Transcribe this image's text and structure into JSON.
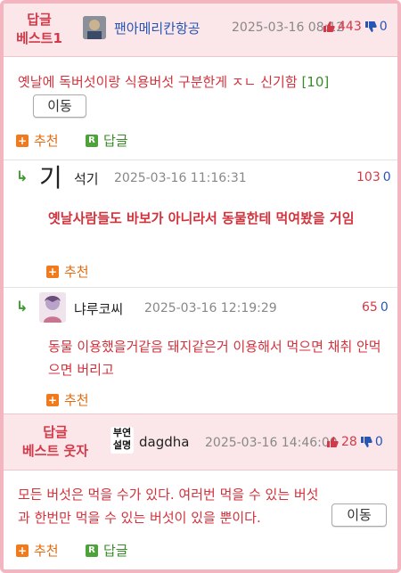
{
  "comments": [
    {
      "badge_line1": "답글",
      "badge_line2": "베스트1",
      "nickname": "팬아메리칸항공",
      "date": "2025-03-16 08:12",
      "up": "443",
      "down": "0",
      "text": "옛날에 독버섯이랑 식용버섯 구분한게 ㅈㄴ 신기함",
      "count": "[10]",
      "move_button": "이동",
      "recommend": "추천",
      "reply": "답글"
    },
    {
      "nickname": "석기",
      "date": "2025-03-16 11:16:31",
      "up": "103",
      "down": "0",
      "text": "옛날사람들도 바보가 아니라서 동물한테 먹여봤을 거임",
      "recommend": "추천"
    },
    {
      "nickname": "냐루코씨",
      "date": "2025-03-16 12:19:29",
      "up": "65",
      "down": "0",
      "text": "동물 이용했을거같음 돼지같은거 이용해서 먹으면 채취 안먹으면 버리고",
      "recommend": "추천"
    },
    {
      "badge_line1": "답글",
      "badge_line2": "베스트 웃자",
      "nickname": "dagdha",
      "date": "2025-03-16 14:46:00",
      "up": "28",
      "down": "0",
      "text": "모든 버섯은 먹을 수가 있다. 여러번 먹을 수 있는 버섯과 한번만 먹을 수 있는 버섯이 있을 뿐이다.",
      "move_button": "이동",
      "recommend": "추천",
      "reply": "답글"
    }
  ],
  "avatars": {
    "c2_glyph": "기",
    "c4_line1": "부연",
    "c4_line2": "설명"
  },
  "colors": {
    "accent_red": "#d2323c",
    "best_bg": "#fbe7ea",
    "frame_pink": "#f3b5bf",
    "link_blue": "#2755b5"
  },
  "icons": {
    "thumb_up": "thumb-up-icon",
    "thumb_down": "thumb-down-icon",
    "recommend": "plus-icon",
    "reply": "reply-r-icon",
    "reply_arrow": "reply-arrow-icon"
  }
}
